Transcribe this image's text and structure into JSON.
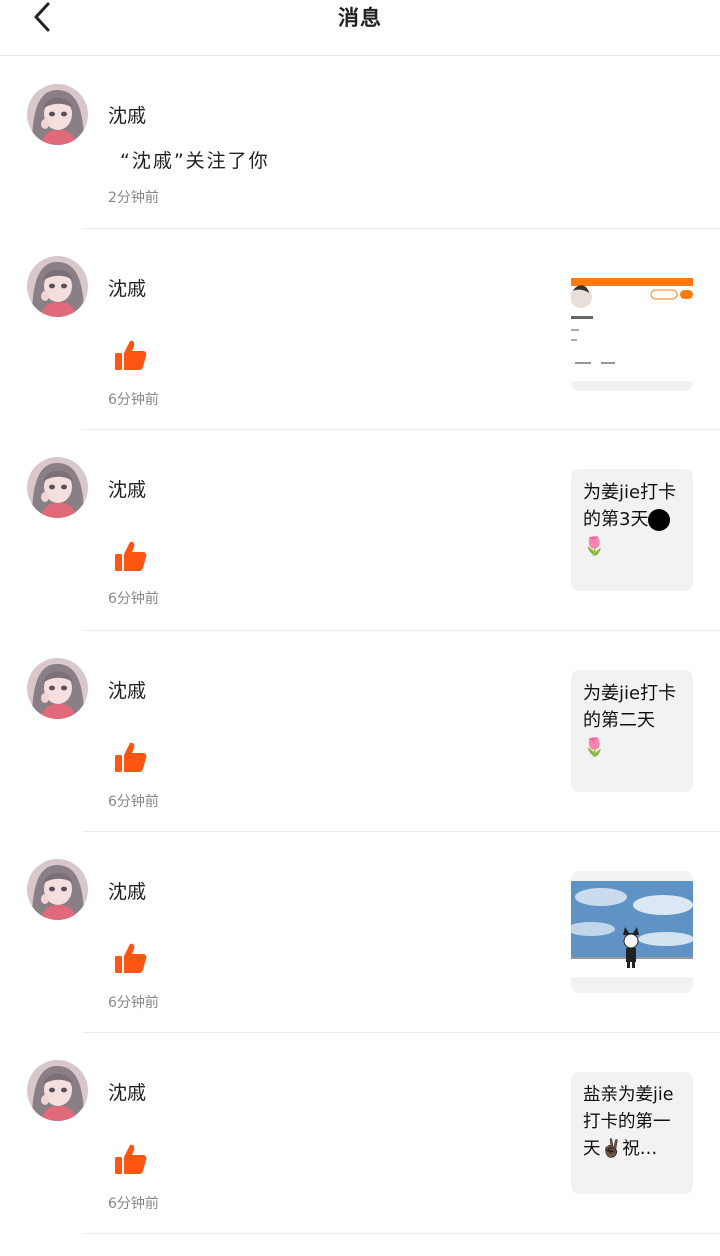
{
  "header": {
    "title": "消息"
  },
  "notifications": [
    {
      "name": "沈戚",
      "text": "“沈戚”关注了你",
      "time": "2分钟前"
    },
    {
      "name": "沈戚",
      "time": "6分钟前"
    },
    {
      "name": "沈戚",
      "time": "6分钟前",
      "post_text": "为姜jie打卡的第3天",
      "post_emoji": "🌷"
    },
    {
      "name": "沈戚",
      "time": "6分钟前",
      "post_text": "为姜jie打卡的第二天",
      "post_emoji": "🌷"
    },
    {
      "name": "沈戚",
      "time": "6分钟前"
    },
    {
      "name": "沈戚",
      "time": "6分钟前",
      "post_text": "盐亲为姜jie打卡的第一天",
      "post_emoji": "✌🏿",
      "post_tail": "祝…"
    }
  ],
  "colors": {
    "like": "#ff5512",
    "accent": "#ff7a10"
  }
}
